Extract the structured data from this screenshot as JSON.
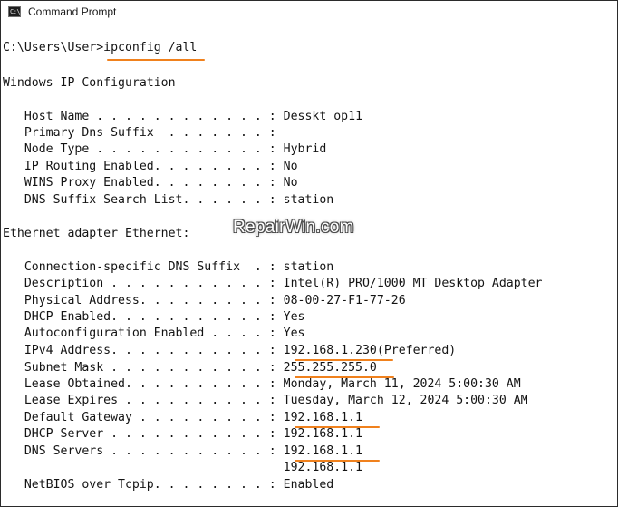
{
  "window": {
    "title": "Command Prompt",
    "icon": "cmd-icon",
    "icon_glyph": "C:\\"
  },
  "watermark": "RepairWin.com",
  "underline_color": "#f0811d",
  "console": {
    "prompt": "C:\\Users\\User>",
    "command": "ipconfig /all",
    "heading": "Windows IP Configuration",
    "global_config": [
      {
        "label": "   Host Name . . . . . . . . . . . . : ",
        "value": "Desskt op11"
      },
      {
        "label": "   Primary Dns Suffix  . . . . . . . : ",
        "value": ""
      },
      {
        "label": "   Node Type . . . . . . . . . . . . : ",
        "value": "Hybrid"
      },
      {
        "label": "   IP Routing Enabled. . . . . . . . : ",
        "value": "No"
      },
      {
        "label": "   WINS Proxy Enabled. . . . . . . . : ",
        "value": "No"
      },
      {
        "label": "   DNS Suffix Search List. . . . . . : ",
        "value": "station"
      }
    ],
    "adapter_heading": "Ethernet adapter Ethernet:",
    "adapter_config": [
      {
        "label": "   Connection-specific DNS Suffix  . : ",
        "value": "station",
        "suffix": ""
      },
      {
        "label": "   Description . . . . . . . . . . . : ",
        "value": "Intel(R) PRO/1000 MT Desktop Adapter",
        "suffix": ""
      },
      {
        "label": "   Physical Address. . . . . . . . . : ",
        "value": "08-00-27-F1-77-26",
        "suffix": ""
      },
      {
        "label": "   DHCP Enabled. . . . . . . . . . . : ",
        "value": "Yes",
        "suffix": ""
      },
      {
        "label": "   Autoconfiguration Enabled . . . . : ",
        "value": "Yes",
        "suffix": ""
      },
      {
        "label": "   IPv4 Address. . . . . . . . . . . : ",
        "value": "192.168.1.230",
        "suffix": "(Preferred)"
      },
      {
        "label": "   Subnet Mask . . . . . . . . . . . : ",
        "value": "255.255.255.0",
        "suffix": ""
      },
      {
        "label": "   Lease Obtained. . . . . . . . . . : ",
        "value": "Monday, March 11, 2024 5:00:30 AM",
        "suffix": ""
      },
      {
        "label": "   Lease Expires . . . . . . . . . . : ",
        "value": "Tuesday, March 12, 2024 5:00:30 AM",
        "suffix": ""
      },
      {
        "label": "   Default Gateway . . . . . . . . . : ",
        "value": "192.168.1.1",
        "suffix": ""
      },
      {
        "label": "   DHCP Server . . . . . . . . . . . : ",
        "value": "192.168.1.1",
        "suffix": ""
      },
      {
        "label": "   DNS Servers . . . . . . . . . . . : ",
        "value": "192.168.1.1",
        "suffix": ""
      },
      {
        "label": "                                       ",
        "value": "192.168.1.1",
        "suffix": ""
      },
      {
        "label": "   NetBIOS over Tcpip. . . . . . . . : ",
        "value": "Enabled",
        "suffix": ""
      }
    ]
  }
}
